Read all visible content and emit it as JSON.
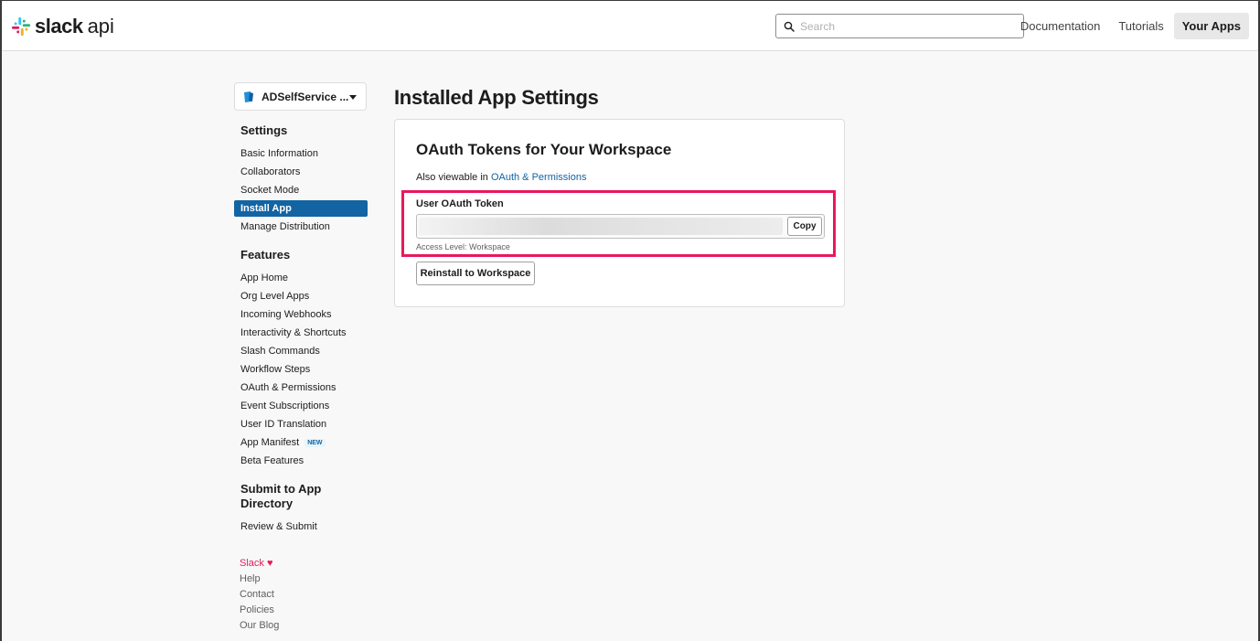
{
  "header": {
    "brand_bold": "slack",
    "brand_light": "api",
    "search_placeholder": "Search",
    "nav": [
      {
        "label": "Documentation"
      },
      {
        "label": "Tutorials"
      },
      {
        "label": "Your Apps",
        "active": true
      }
    ]
  },
  "sidebar": {
    "app_name": "ADSelfService ...",
    "sections": [
      {
        "title": "Settings",
        "items": [
          "Basic Information",
          "Collaborators",
          "Socket Mode",
          "Install App",
          "Manage Distribution"
        ]
      },
      {
        "title": "Features",
        "items": [
          "App Home",
          "Org Level Apps",
          "Incoming Webhooks",
          "Interactivity & Shortcuts",
          "Slash Commands",
          "Workflow Steps",
          "OAuth & Permissions",
          "Event Subscriptions",
          "User ID Translation",
          "App Manifest",
          "Beta Features"
        ]
      },
      {
        "title": "Submit to App Directory",
        "items": [
          "Review & Submit"
        ]
      }
    ],
    "active_item": "Install App",
    "new_badge": "NEW"
  },
  "footer": {
    "slack": "Slack",
    "links": [
      "Help",
      "Contact",
      "Policies",
      "Our Blog"
    ]
  },
  "main": {
    "title": "Installed App Settings",
    "card": {
      "heading": "OAuth Tokens for Your Workspace",
      "also_prefix": "Also viewable in",
      "also_link": "OAuth & Permissions",
      "token_label": "User OAuth Token",
      "copy_label": "Copy",
      "access_level": "Access Level: Workspace",
      "reinstall_label": "Reinstall to Workspace"
    }
  },
  "colors": {
    "accent": "#1264a3",
    "highlight": "#e8195a",
    "slack_pink": "#e01e5a"
  }
}
